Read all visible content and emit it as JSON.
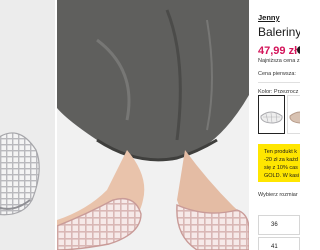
{
  "product": {
    "brand": "Jenny",
    "title": "Baleriny",
    "price": "47,99 zł",
    "lowest_price_label": "Najniższa cena z",
    "first_price_label": "Cena pierwsza:",
    "color_label": "Kolor: Przezrocz",
    "price_color": "#d4145a"
  },
  "promo": {
    "lines": [
      "Ten produkt k",
      "-20 zł za każd",
      "się z 10% cas",
      "GOLD. W kasi"
    ],
    "background": "#ffe600"
  },
  "sizes": {
    "label": "Wybierz rozmiar",
    "options": [
      "36",
      "41"
    ]
  },
  "icons": {
    "price_info": "info-icon"
  }
}
